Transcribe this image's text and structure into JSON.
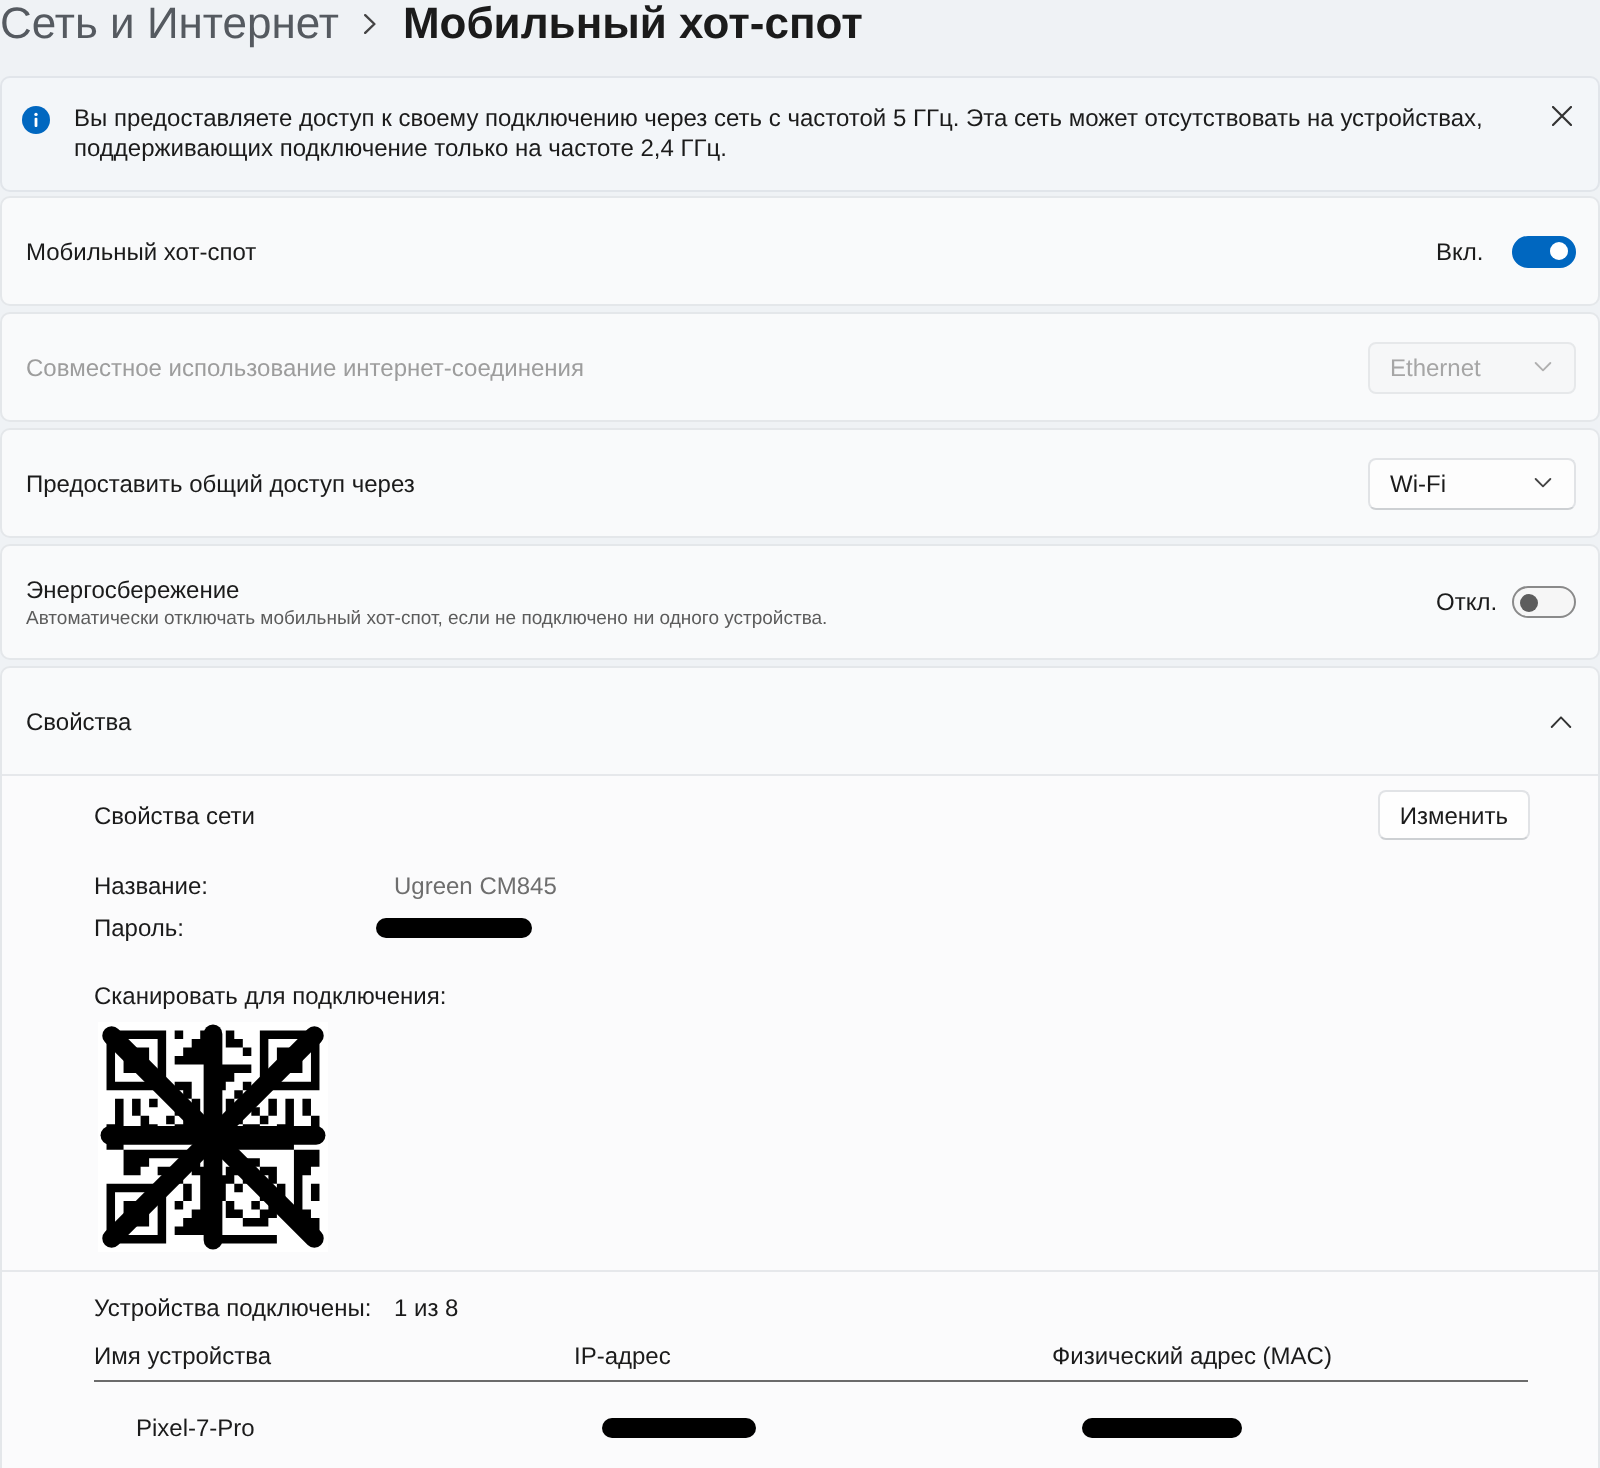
{
  "breadcrumb": {
    "parent": "Сеть и Интернет",
    "current": "Мобильный хот-спот"
  },
  "info_bar": {
    "text": "Вы предоставляете доступ к своему подключению через сеть с частотой 5 ГГц. Эта сеть может отсутствовать на устройствах, поддерживающих подключение только на частоте 2,4 ГГц."
  },
  "settings": [
    {
      "kind": "toggle",
      "label": "Мобильный хот-спот",
      "disabled": false,
      "state_label": "Вкл.",
      "on": true
    },
    {
      "kind": "dropdown",
      "label": "Совместное использование интернет-соединения",
      "disabled": true,
      "value": "Ethernet"
    },
    {
      "kind": "dropdown",
      "label": "Предоставить общий доступ через",
      "disabled": false,
      "value": "Wi-Fi"
    },
    {
      "kind": "toggle",
      "label": "Энергосбережение",
      "description": "Автоматически отключать мобильный хот-спот, если не подключено ни одного устройства.",
      "disabled": false,
      "state_label": "Откл.",
      "on": false
    }
  ],
  "properties": {
    "title": "Свойства",
    "expanded": true,
    "network": {
      "heading": "Свойства сети",
      "edit_button": "Изменить",
      "fields": [
        {
          "label": "Название:",
          "value": "Ugreen CM845"
        },
        {
          "label": "Пароль:"
        }
      ],
      "qr_label": "Сканировать для подключения:"
    },
    "devices": {
      "label": "Устройства подключены:",
      "count": "1 из 8",
      "columns": [
        "Имя устройства",
        "IP-адрес",
        "Физический адрес (MAC)"
      ],
      "rows": [
        {
          "name": "Pixel-7-Pro"
        }
      ]
    }
  }
}
